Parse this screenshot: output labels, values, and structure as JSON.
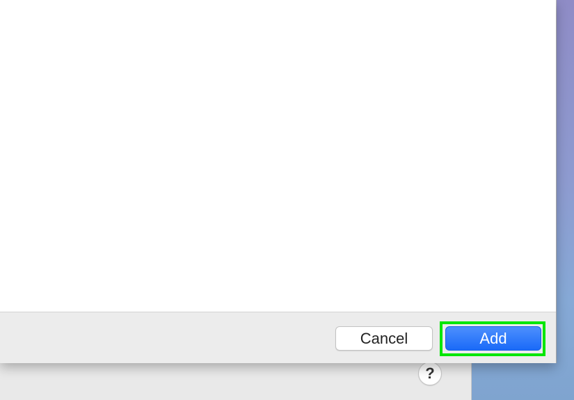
{
  "dialog": {
    "cancel_label": "Cancel",
    "add_label": "Add"
  },
  "background_window": {
    "help_label": "?"
  },
  "colors": {
    "primary_button": "#1a6af8",
    "highlight": "#00e600"
  }
}
